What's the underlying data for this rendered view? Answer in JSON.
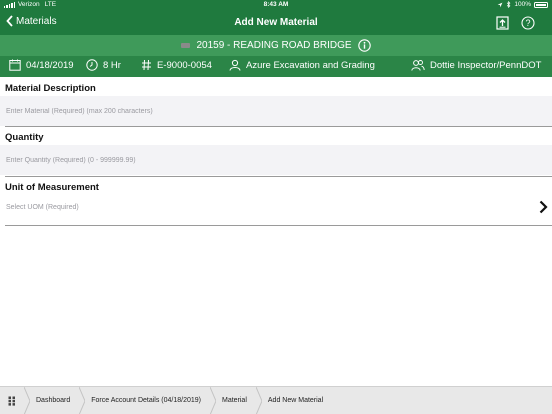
{
  "status_bar": {
    "carrier": "Verizon",
    "network": "LTE",
    "time": "8:43 AM",
    "battery": "100%"
  },
  "nav": {
    "back_label": "Materials",
    "title": "Add New Material"
  },
  "project": {
    "name": "20159 - READING ROAD BRIDGE"
  },
  "info": {
    "date": "04/18/2019",
    "hours": "8 Hr",
    "contract": "E-9000-0054",
    "contractor": "Azure Excavation and Grading",
    "inspector": "Dottie Inspector/PennDOT"
  },
  "form": {
    "material_description": {
      "label": "Material Description",
      "placeholder": "Enter Material (Required) (max 200 characters)"
    },
    "quantity": {
      "label": "Quantity",
      "placeholder": "Enter Quantity (Required) (0 - 999999.99)"
    },
    "uom": {
      "label": "Unit of Measurement",
      "placeholder": "Select UOM (Required)"
    }
  },
  "breadcrumb": [
    "Dashboard",
    "Force Account Details (04/18/2019)",
    "Material",
    "Add New Material"
  ],
  "colors": {
    "nav_green": "#1f7a3e",
    "project_green": "#3f9a5a",
    "info_green": "#2b8547"
  }
}
